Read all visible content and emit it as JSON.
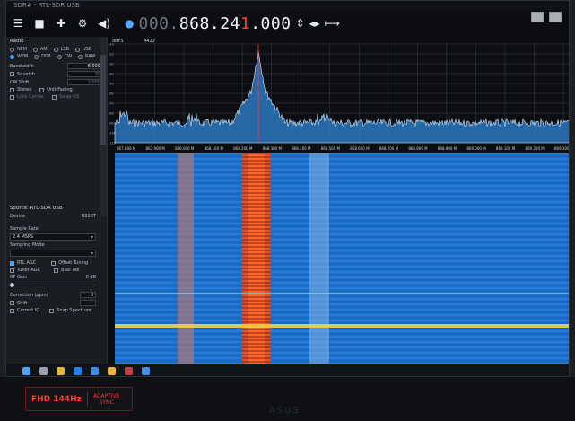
{
  "app": {
    "window_title": "SDR# - RTL-SDR USB"
  },
  "toolbar": {
    "icons": [
      "menu-icon",
      "stop-icon",
      "add-icon",
      "settings-icon",
      "volume-icon"
    ],
    "frequency_dim": "000.",
    "frequency_bright": "868.24",
    "frequency_caret": "1",
    "frequency_tail": ".000",
    "zoom": "A422"
  },
  "left_panel": {
    "radio_header": "Radio",
    "modes_row1": [
      "NFM",
      "AM",
      "LSB",
      "USB"
    ],
    "modes_row2": [
      "WFM",
      "DSB",
      "CW",
      "RAW"
    ],
    "bandwidth_label": "Bandwidth",
    "bandwidth_value": "8.000",
    "squelch_label": "Squelch",
    "squelch_value": "30",
    "cw_shift_label": "CW Shift",
    "cw_shift_value": "1.000",
    "options_row1": [
      "Stereo",
      "Unit-Fading"
    ],
    "options_row2": [
      "Lock Carrier",
      "Swap I/Q"
    ],
    "source_header": "Source: RTL-SDR USB",
    "device_label": "Device",
    "device_value": "R820T",
    "sample_rate_label": "Sample Rate",
    "sample_rate_value": "2.4 MSPS",
    "sampling_mode_label": "Sampling Mode",
    "check_rows": [
      [
        "RTL AGC",
        "Offset Tuning"
      ],
      [
        "Tuner AGC",
        "Bias Tee"
      ]
    ],
    "rf_gain_label": "RF Gain",
    "rf_gain_value": "0 dB",
    "correction_label": "Correction (ppm)",
    "correction_value": "0",
    "shift_label": "Shift",
    "bottom_checks": [
      "Correct IQ",
      "Snap Spectrum"
    ]
  },
  "spectrum": {
    "title": "A422",
    "y_label": "dBFS",
    "y_ticks": [
      "-10",
      "-20",
      "-30",
      "-40",
      "-50",
      "-60",
      "-70",
      "-80",
      "-90",
      "-100",
      "-110"
    ],
    "x_ticks": [
      "867.800 M",
      "867.900 M",
      "868.000 M",
      "868.100 M",
      "868.200 M",
      "868.300 M",
      "868.400 M",
      "868.500 M",
      "868.600 M",
      "868.700 M",
      "868.800 M",
      "868.900 M",
      "869.000 M",
      "869.100 M",
      "869.200 M",
      "869.300 M"
    ]
  },
  "taskbar": {
    "icons": [
      "start-icon",
      "search-icon",
      "chrome-icon",
      "explorer-icon",
      "vscode-icon",
      "folder-icon",
      "store-icon",
      "app-icon"
    ]
  },
  "laptop": {
    "badge_left": "FHD 144Hz",
    "badge_right_top": "ADAPTIVE",
    "badge_right_bottom": "SYNC",
    "brand": "ASUS"
  },
  "colors": {
    "spectrum_fill": "#2f86d6",
    "waterfall_bg": "#1d6fc9",
    "signal_hot": "#e0532a",
    "signal_warm": "#f1d442"
  }
}
